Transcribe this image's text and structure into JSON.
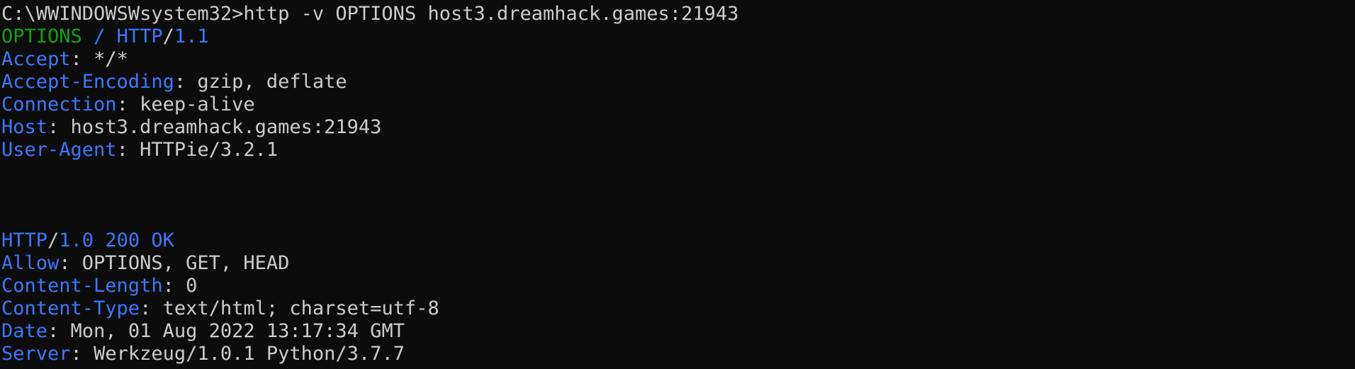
{
  "command_line": "C:\\WWINDOWSWsystem32>http -v OPTIONS host3.dreamhack.games:21943",
  "request": {
    "method": "OPTIONS",
    "path": "/",
    "protocol": "HTTP",
    "slash": "/",
    "version": "1.1",
    "headers": [
      {
        "name": "Accept",
        "value": "*/*"
      },
      {
        "name": "Accept-Encoding",
        "value": "gzip, deflate"
      },
      {
        "name": "Connection",
        "value": "keep-alive"
      },
      {
        "name": "Host",
        "value": "host3.dreamhack.games:21943"
      },
      {
        "name": "User-Agent",
        "value": "HTTPie/3.2.1"
      }
    ]
  },
  "response": {
    "protocol": "HTTP",
    "slash": "/",
    "version": "1.0",
    "status_code": "200",
    "status_text": "OK",
    "headers": [
      {
        "name": "Allow",
        "value": "OPTIONS, GET, HEAD"
      },
      {
        "name": "Content-Length",
        "value": "0"
      },
      {
        "name": "Content-Type",
        "value": "text/html; charset=utf-8"
      },
      {
        "name": "Date",
        "value": "Mon, 01 Aug 2022 13:17:34 GMT"
      },
      {
        "name": "Server",
        "value": "Werkzeug/1.0.1 Python/3.7.7"
      }
    ]
  },
  "colors": {
    "background": "#0c0c0c",
    "text": "#cccccc",
    "method": "#13a10e",
    "header_name": "#3b78ff",
    "protocol": "#0037da"
  }
}
